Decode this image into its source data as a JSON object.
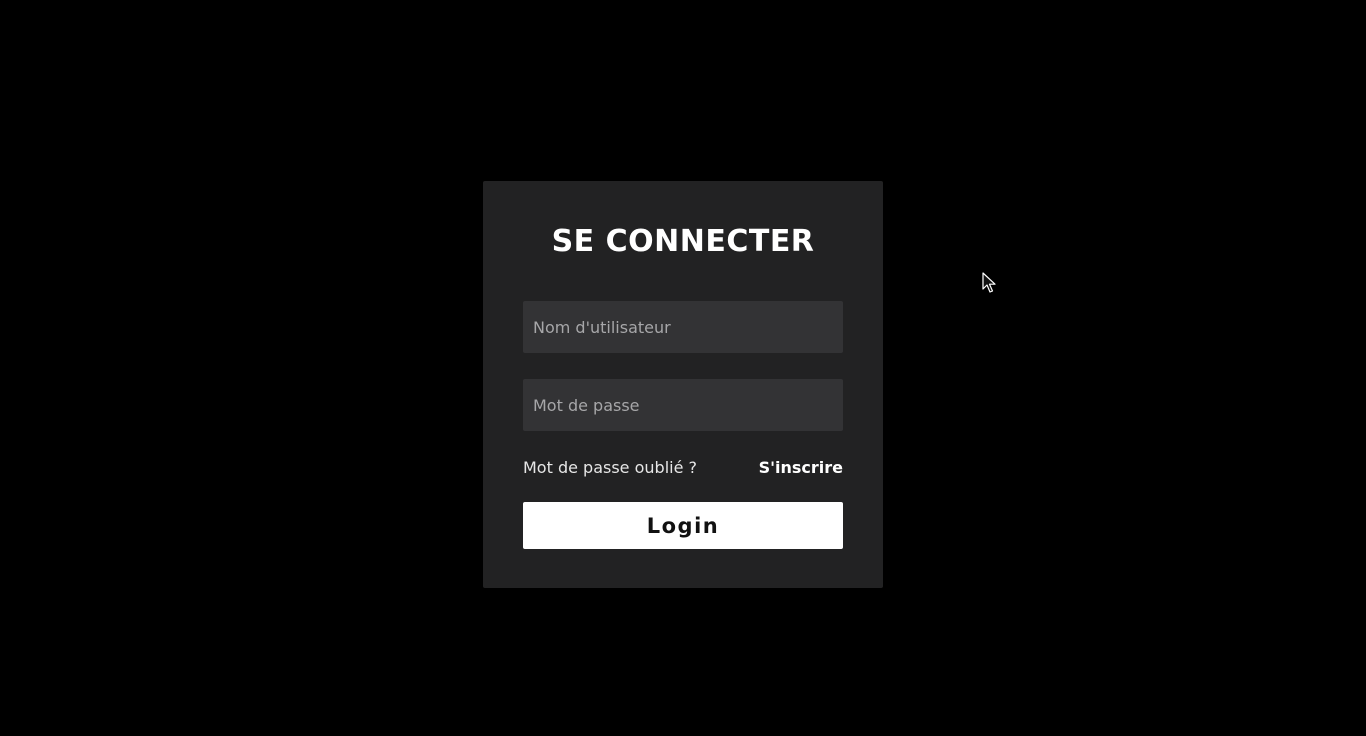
{
  "login": {
    "title": "SE CONNECTER",
    "username_placeholder": "Nom d'utilisateur",
    "username_value": "",
    "password_placeholder": "Mot de passe",
    "password_value": "",
    "forgot_password_label": "Mot de passe oublié ?",
    "signup_label": "S'inscrire",
    "submit_label": "Login"
  },
  "theme": {
    "background": "#000000",
    "card": "#222223",
    "field": "#333335",
    "button": "#ffffff"
  },
  "icons": {
    "cursor": "mouse-pointer-icon"
  }
}
